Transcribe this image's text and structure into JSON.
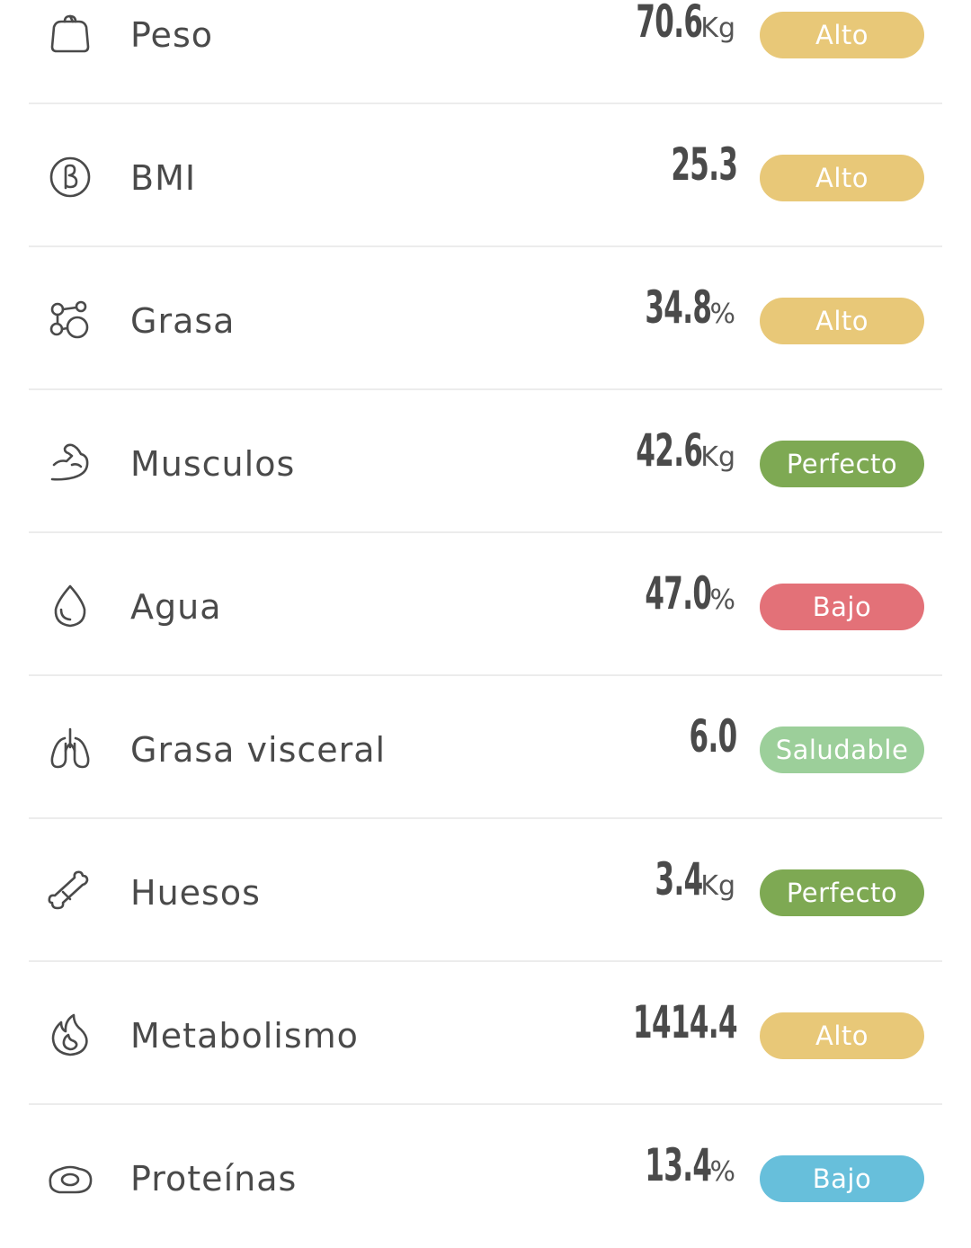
{
  "metrics": [
    {
      "label": "Peso",
      "value": "70.6",
      "unit": "Kg",
      "status": "Alto",
      "status_color": "#e8c878",
      "icon": "scale-icon"
    },
    {
      "label": "BMI",
      "value": "25.3",
      "unit": "",
      "status": "Alto",
      "status_color": "#e8c878",
      "icon": "bmi-icon"
    },
    {
      "label": "Grasa",
      "value": "34.8",
      "unit": "%",
      "status": "Alto",
      "status_color": "#e8c878",
      "icon": "fat-cells-icon"
    },
    {
      "label": "Musculos",
      "value": "42.6",
      "unit": "Kg",
      "status": "Perfecto",
      "status_color": "#7ea953",
      "icon": "muscle-arm-icon"
    },
    {
      "label": "Agua",
      "value": "47.0",
      "unit": "%",
      "status": "Bajo",
      "status_color": "#e37178",
      "icon": "water-drop-icon"
    },
    {
      "label": "Grasa visceral",
      "value": "6.0",
      "unit": "",
      "status": "Saludable",
      "status_color": "#9ccf9a",
      "icon": "lungs-icon"
    },
    {
      "label": "Huesos",
      "value": "3.4",
      "unit": "Kg",
      "status": "Perfecto",
      "status_color": "#7ea953",
      "icon": "bone-icon"
    },
    {
      "label": "Metabolismo",
      "value": "1414.4",
      "unit": "",
      "status": "Alto",
      "status_color": "#e8c878",
      "icon": "flame-icon"
    },
    {
      "label": "Proteínas",
      "value": "13.4",
      "unit": "%",
      "status": "Bajo",
      "status_color": "#67bfdb",
      "icon": "protein-icon"
    }
  ]
}
